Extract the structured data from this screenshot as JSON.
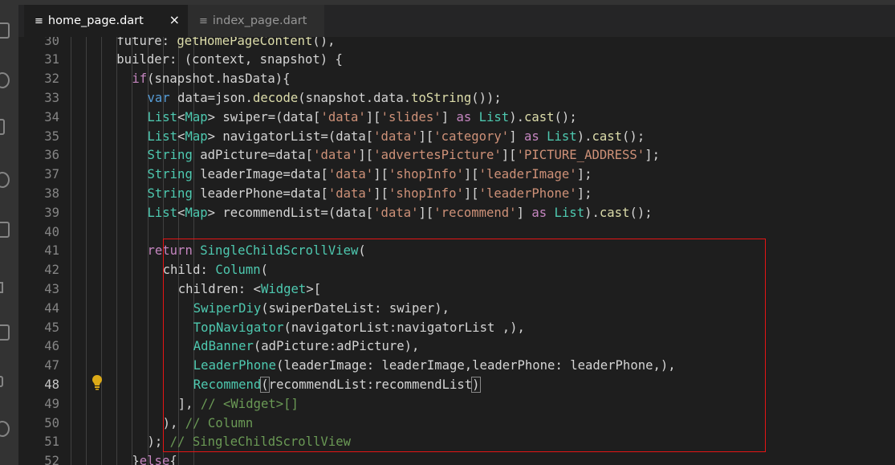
{
  "tabs": [
    {
      "label": "home_page.dart",
      "icon": "file-icon",
      "active": true,
      "close": "×"
    },
    {
      "label": "index_page.dart",
      "icon": "file-icon",
      "active": false
    }
  ],
  "icons": {
    "file": "≡",
    "bulb": "lightbulb-icon"
  },
  "colors": {
    "keyword": "#569cd6",
    "control": "#c586c0",
    "function": "#dcdcaa",
    "string": "#ce9178",
    "type": "#4ec9b0",
    "variable": "#9cdcfe",
    "comment": "#6a9955",
    "highlight_border": "#e51515"
  },
  "lines": [
    {
      "num": "30",
      "indent": 3,
      "tokens": [
        [
          "def",
          "future: "
        ],
        [
          "fn",
          "getHomePageContent"
        ],
        [
          "def",
          "(),"
        ]
      ]
    },
    {
      "num": "31",
      "indent": 3,
      "tokens": [
        [
          "def",
          "builder: (context, snapshot) {"
        ]
      ]
    },
    {
      "num": "32",
      "indent": 4,
      "tokens": [
        [
          "ctl",
          "if"
        ],
        [
          "def",
          "(snapshot.hasData){"
        ]
      ]
    },
    {
      "num": "33",
      "indent": 5,
      "tokens": [
        [
          "kw",
          "var"
        ],
        [
          "def",
          " data=json."
        ],
        [
          "fn",
          "decode"
        ],
        [
          "def",
          "(snapshot.data."
        ],
        [
          "fn",
          "toString"
        ],
        [
          "def",
          "());"
        ]
      ]
    },
    {
      "num": "34",
      "indent": 5,
      "tokens": [
        [
          "type",
          "List"
        ],
        [
          "def",
          "<"
        ],
        [
          "type",
          "Map"
        ],
        [
          "def",
          "> swiper=(data["
        ],
        [
          "str",
          "'data'"
        ],
        [
          "def",
          "]["
        ],
        [
          "str",
          "'slides'"
        ],
        [
          "def",
          "] "
        ],
        [
          "ctl",
          "as"
        ],
        [
          "def",
          " "
        ],
        [
          "type",
          "List"
        ],
        [
          "def",
          ")."
        ],
        [
          "fn",
          "cast"
        ],
        [
          "def",
          "();"
        ]
      ]
    },
    {
      "num": "35",
      "indent": 5,
      "tokens": [
        [
          "type",
          "List"
        ],
        [
          "def",
          "<"
        ],
        [
          "type",
          "Map"
        ],
        [
          "def",
          "> navigatorList=(data["
        ],
        [
          "str",
          "'data'"
        ],
        [
          "def",
          "]["
        ],
        [
          "str",
          "'category'"
        ],
        [
          "def",
          "] "
        ],
        [
          "ctl",
          "as"
        ],
        [
          "def",
          " "
        ],
        [
          "type",
          "List"
        ],
        [
          "def",
          ")."
        ],
        [
          "fn",
          "cast"
        ],
        [
          "def",
          "();"
        ]
      ]
    },
    {
      "num": "36",
      "indent": 5,
      "tokens": [
        [
          "type",
          "String"
        ],
        [
          "def",
          " adPicture=data["
        ],
        [
          "str",
          "'data'"
        ],
        [
          "def",
          "]["
        ],
        [
          "str",
          "'advertesPicture'"
        ],
        [
          "def",
          "]["
        ],
        [
          "str",
          "'PICTURE_ADDRESS'"
        ],
        [
          "def",
          "];"
        ]
      ]
    },
    {
      "num": "37",
      "indent": 5,
      "tokens": [
        [
          "type",
          "String"
        ],
        [
          "def",
          " leaderImage=data["
        ],
        [
          "str",
          "'data'"
        ],
        [
          "def",
          "]["
        ],
        [
          "str",
          "'shopInfo'"
        ],
        [
          "def",
          "]["
        ],
        [
          "str",
          "'leaderImage'"
        ],
        [
          "def",
          "];"
        ]
      ]
    },
    {
      "num": "38",
      "indent": 5,
      "tokens": [
        [
          "type",
          "String"
        ],
        [
          "def",
          " leaderPhone=data["
        ],
        [
          "str",
          "'data'"
        ],
        [
          "def",
          "]["
        ],
        [
          "str",
          "'shopInfo'"
        ],
        [
          "def",
          "]["
        ],
        [
          "str",
          "'leaderPhone'"
        ],
        [
          "def",
          "];"
        ]
      ]
    },
    {
      "num": "39",
      "indent": 5,
      "tokens": [
        [
          "type",
          "List"
        ],
        [
          "def",
          "<"
        ],
        [
          "type",
          "Map"
        ],
        [
          "def",
          "> recommendList=(data["
        ],
        [
          "str",
          "'data'"
        ],
        [
          "def",
          "]["
        ],
        [
          "str",
          "'recommend'"
        ],
        [
          "def",
          "] "
        ],
        [
          "ctl",
          "as"
        ],
        [
          "def",
          " "
        ],
        [
          "type",
          "List"
        ],
        [
          "def",
          ")."
        ],
        [
          "fn",
          "cast"
        ],
        [
          "def",
          "();"
        ]
      ]
    },
    {
      "num": "40",
      "indent": 0,
      "tokens": []
    },
    {
      "num": "41",
      "indent": 5,
      "tokens": [
        [
          "ctl",
          "return"
        ],
        [
          "def",
          " "
        ],
        [
          "type",
          "SingleChildScrollView"
        ],
        [
          "def",
          "("
        ]
      ]
    },
    {
      "num": "42",
      "indent": 6,
      "tokens": [
        [
          "def",
          "child: "
        ],
        [
          "type",
          "Column"
        ],
        [
          "def",
          "("
        ]
      ]
    },
    {
      "num": "43",
      "indent": 7,
      "tokens": [
        [
          "def",
          "children: <"
        ],
        [
          "type",
          "Widget"
        ],
        [
          "def",
          ">["
        ]
      ]
    },
    {
      "num": "44",
      "indent": 8,
      "tokens": [
        [
          "type",
          "SwiperDiy"
        ],
        [
          "def",
          "(swiperDateList: swiper),"
        ]
      ]
    },
    {
      "num": "45",
      "indent": 8,
      "tokens": [
        [
          "type",
          "TopNavigator"
        ],
        [
          "def",
          "(navigatorList:navigatorList ,),"
        ]
      ]
    },
    {
      "num": "46",
      "indent": 8,
      "tokens": [
        [
          "type",
          "AdBanner"
        ],
        [
          "def",
          "(adPicture:adPicture),"
        ]
      ]
    },
    {
      "num": "47",
      "indent": 8,
      "tokens": [
        [
          "type",
          "LeaderPhone"
        ],
        [
          "def",
          "(leaderImage: leaderImage,leaderPhone: leaderPhone,),"
        ]
      ]
    },
    {
      "num": "48",
      "indent": 8,
      "tokens": [
        [
          "type",
          "Recommend"
        ],
        [
          "bm",
          "("
        ],
        [
          "def",
          "recommendList:recommendList"
        ],
        [
          "bm",
          ")"
        ]
      ],
      "current": true
    },
    {
      "num": "49",
      "indent": 7,
      "tokens": [
        [
          "def",
          "], "
        ],
        [
          "cmt",
          "// <Widget>[]"
        ]
      ]
    },
    {
      "num": "50",
      "indent": 6,
      "tokens": [
        [
          "def",
          "), "
        ],
        [
          "cmt",
          "// Column"
        ]
      ]
    },
    {
      "num": "51",
      "indent": 5,
      "tokens": [
        [
          "def",
          "); "
        ],
        [
          "cmt",
          "// SingleChildScrollView"
        ]
      ]
    },
    {
      "num": "52",
      "indent": 4,
      "tokens": [
        [
          "def",
          "}"
        ],
        [
          "ctl",
          "else"
        ],
        [
          "def",
          "{"
        ]
      ]
    }
  ]
}
